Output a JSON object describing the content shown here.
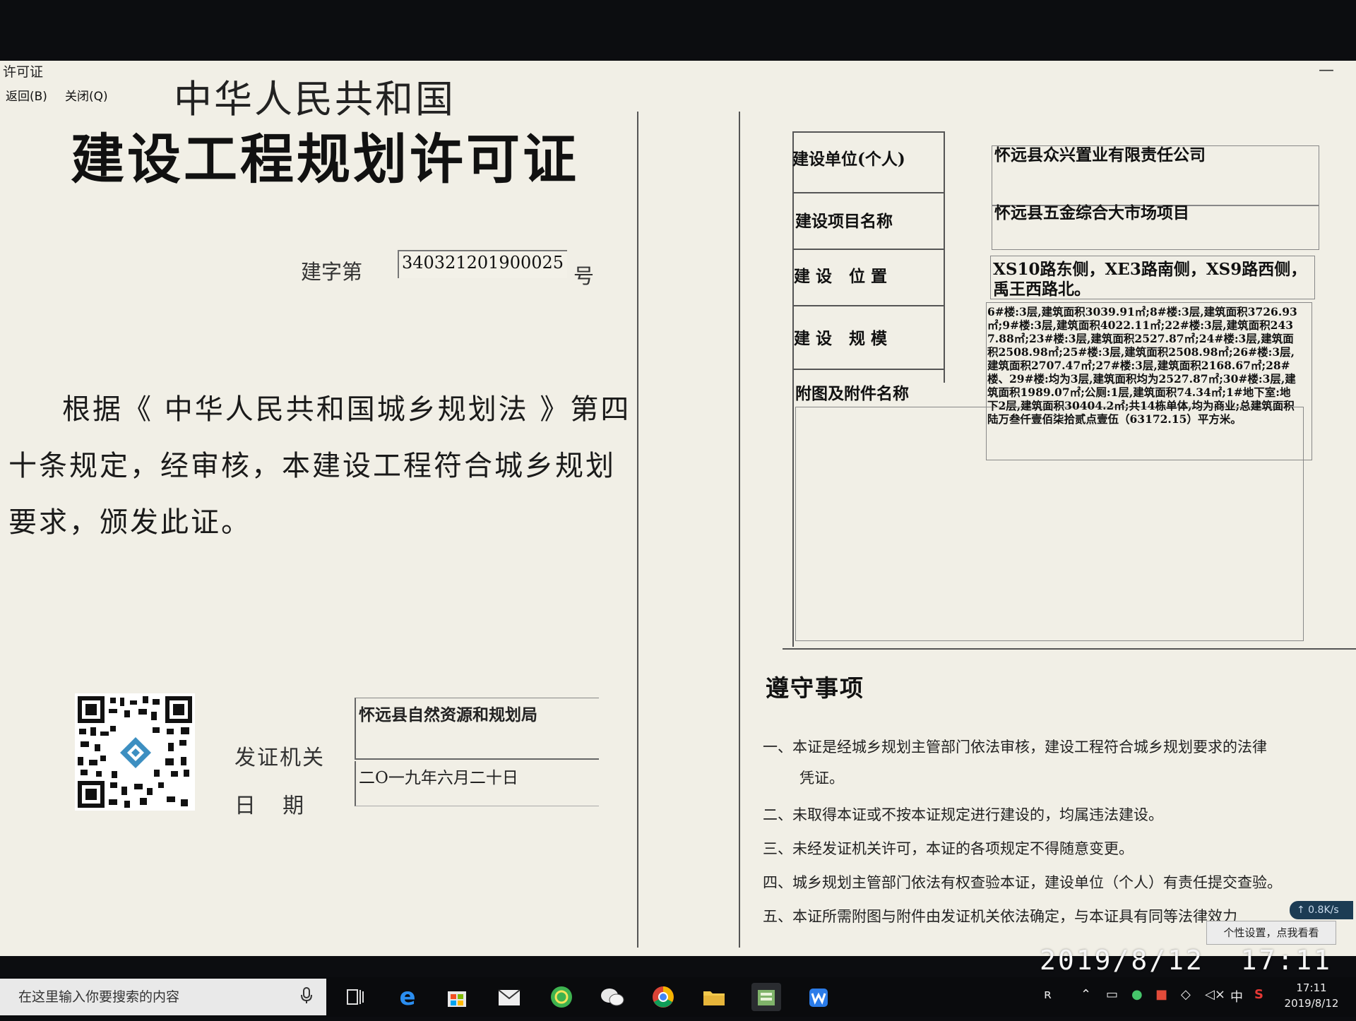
{
  "window": {
    "title": "许可证",
    "minimize_glyph": "—",
    "menu": [
      {
        "label": "返回(B)"
      },
      {
        "label": "关闭(Q)"
      }
    ]
  },
  "certificate": {
    "subtitle": "中华人民共和国",
    "title": "建设工程规划许可证",
    "number_prefix": "建字第",
    "number": "340321201900025",
    "number_suffix": "号",
    "body": "根据《 中华人民共和国城乡规划法 》第四十条规定，经审核，本建设工程符合城乡规划要求，颁发此证。",
    "issuer_label": "发证机关",
    "issuer": "怀远县自然资源和规划局",
    "date_label": "日    期",
    "date": "二O一九年六月二十日"
  },
  "details": {
    "rows": [
      {
        "label": "建设单位(个人)",
        "value": "怀远县众兴置业有限责任公司"
      },
      {
        "label": "建设项目名称",
        "value": "怀远县五金综合大市场项目"
      },
      {
        "label": "建 设   位 置",
        "value": "XS10路东侧，XE3路南侧，XS9路西侧，禹王西路北。"
      },
      {
        "label": "建 设   规 模",
        "value": "6#楼:3层,建筑面积3039.91㎡;8#楼:3层,建筑面积3726.93㎡;9#楼:3层,建筑面积4022.11㎡;22#楼:3层,建筑面积2437.88㎡;23#楼:3层,建筑面积2527.87㎡;24#楼:3层,建筑面积2508.98㎡;25#楼:3层,建筑面积2508.98㎡;26#楼:3层,建筑面积2707.47㎡;27#楼:3层,建筑面积2168.67㎡;28#楼、29#楼:均为3层,建筑面积均为2527.87㎡;30#楼:3层,建筑面积1989.07㎡;公厕:1层,建筑面积74.34㎡;1#地下室:地下2层,建筑面积30404.2㎡;共14栋单体,均为商业;总建筑面积陆万叁仟壹佰柒拾贰点壹伍（63172.15）平方米。"
      },
      {
        "label": "附图及附件名称",
        "value": ""
      }
    ]
  },
  "notes": {
    "title": "遵守事项",
    "items": [
      "一、本证是经城乡规划主管部门依法审核，建设工程符合城乡规划要求的法律",
      "凭证。",
      "二、未取得本证或不按本证规定进行建设的，均属违法建设。",
      "三、未经发证机关许可，本证的各项规定不得随意变更。",
      "四、城乡规划主管部门依法有权查验本证，建设单位（个人）有责任提交查验。",
      "五、本证所需附图与附件由发证机关依法确定，与本证具有同等法律效力"
    ]
  },
  "overlay": {
    "net_speed": "↑ 0.8K/s",
    "tip": "个性设置，点我看看",
    "photo_timestamp": "2019/8/12  17:11"
  },
  "taskbar": {
    "search_placeholder": "在这里输入你要搜索的内容",
    "apps": [
      {
        "icon": "task-view-icon"
      },
      {
        "icon": "edge-browser-icon"
      },
      {
        "icon": "store-icon"
      },
      {
        "icon": "mail-icon"
      },
      {
        "icon": "360-browser-icon"
      },
      {
        "icon": "wechat-icon"
      },
      {
        "icon": "chrome-icon"
      },
      {
        "icon": "file-explorer-icon"
      },
      {
        "icon": "active-app-icon"
      },
      {
        "icon": "wps-icon"
      }
    ],
    "ime": "中",
    "clock_time": "17:11",
    "clock_date": "2019/8/12"
  },
  "colors": {
    "window_bg": "#f1efe6",
    "taskbar_bg": "#0a0b0d",
    "search_bg": "#e9e9e9"
  }
}
